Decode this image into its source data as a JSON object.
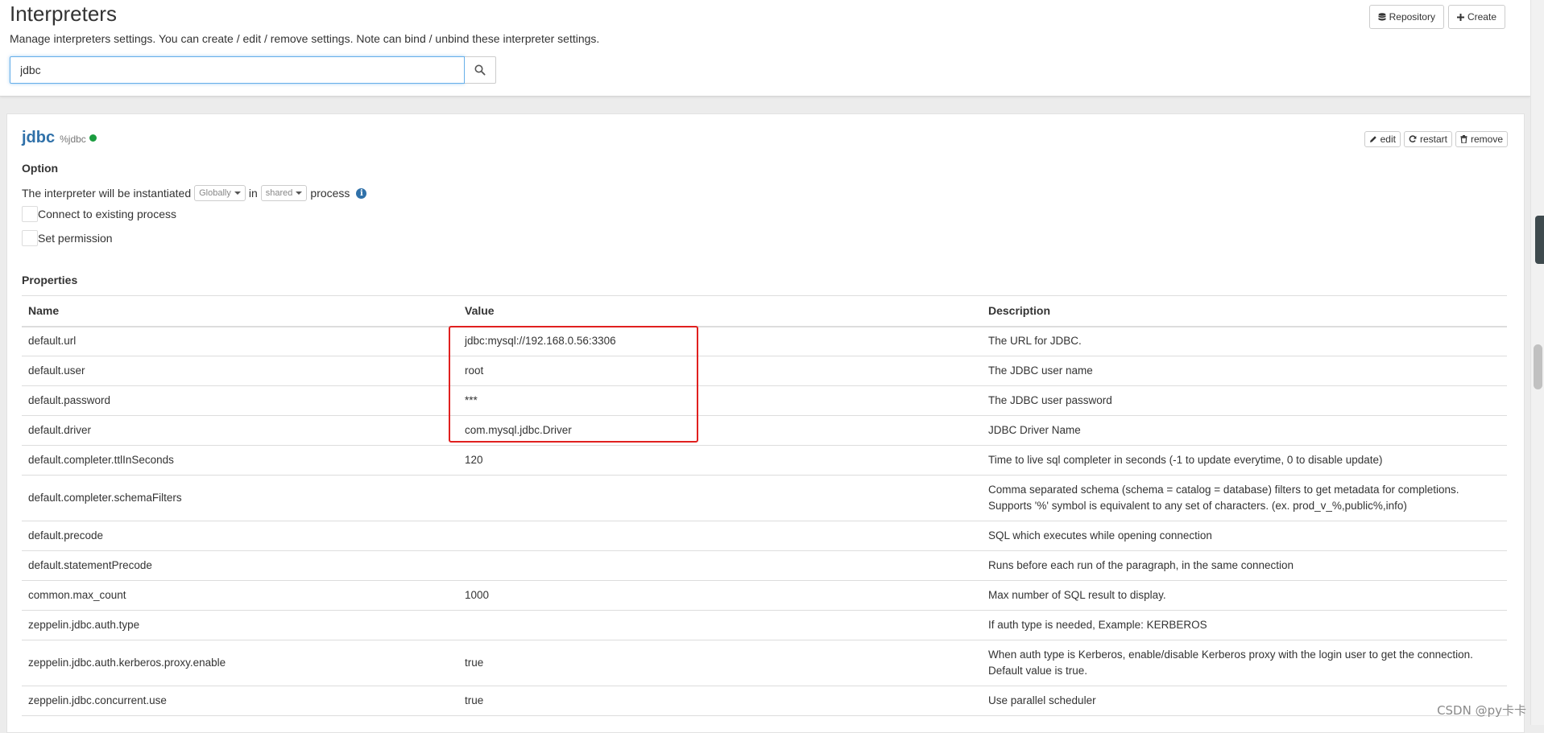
{
  "header": {
    "title": "Interpreters",
    "subtitle": "Manage interpreters settings. You can create / edit / remove settings. Note can bind / unbind these interpreter settings.",
    "search_value": "jdbc",
    "repository_label": "Repository",
    "create_label": "Create"
  },
  "interpreter": {
    "name": "jdbc",
    "alias": "%jdbc",
    "status_color": "#1a9c3f",
    "edit_label": "edit",
    "restart_label": "restart",
    "remove_label": "remove",
    "option_title": "Option",
    "instantiated_text": "The interpreter will be instantiated",
    "scope_value": "Globally",
    "in_text": "in",
    "process_mode_value": "shared",
    "process_text": "process",
    "connect_existing_label": "Connect to existing process",
    "set_permission_label": "Set permission",
    "properties_title": "Properties"
  },
  "table": {
    "headers": [
      "Name",
      "Value",
      "Description"
    ],
    "rows": [
      [
        "default.url",
        "jdbc:mysql://192.168.0.56:3306",
        "The URL for JDBC."
      ],
      [
        "default.user",
        "root",
        "The JDBC user name"
      ],
      [
        "default.password",
        "***",
        "The JDBC user password"
      ],
      [
        "default.driver",
        "com.mysql.jdbc.Driver",
        "JDBC Driver Name"
      ],
      [
        "default.completer.ttlInSeconds",
        "120",
        "Time to live sql completer in seconds (-1 to update everytime, 0 to disable update)"
      ],
      [
        "default.completer.schemaFilters",
        "",
        "Comma separated schema (schema = catalog = database) filters to get metadata for completions. Supports '%' symbol is equivalent to any set of characters. (ex. prod_v_%,public%,info)"
      ],
      [
        "default.precode",
        "",
        "SQL which executes while opening connection"
      ],
      [
        "default.statementPrecode",
        "",
        "Runs before each run of the paragraph, in the same connection"
      ],
      [
        "common.max_count",
        "1000",
        "Max number of SQL result to display."
      ],
      [
        "zeppelin.jdbc.auth.type",
        "",
        "If auth type is needed, Example: KERBEROS"
      ],
      [
        "zeppelin.jdbc.auth.kerberos.proxy.enable",
        "true",
        "When auth type is Kerberos, enable/disable Kerberos proxy with the login user to get the connection. Default value is true."
      ],
      [
        "zeppelin.jdbc.concurrent.use",
        "true",
        "Use parallel scheduler"
      ]
    ]
  },
  "watermark": "CSDN @py卡卡"
}
